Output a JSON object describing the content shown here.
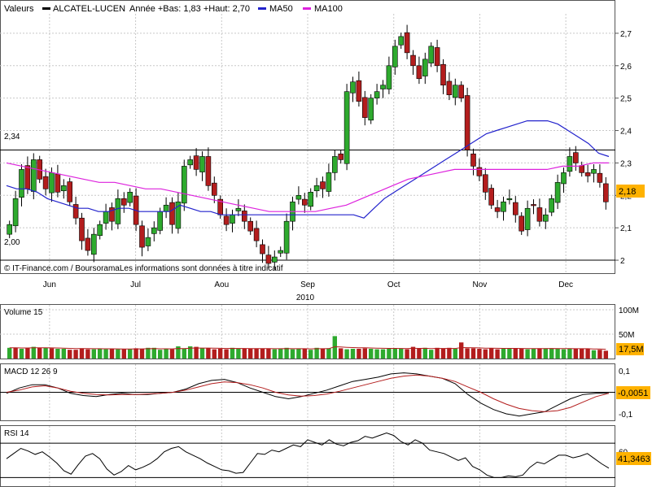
{
  "header": {
    "valeurs_label": "Valeurs",
    "series_label": "ALCATEL-LUCEN",
    "range_text": "Année +Bas: 1,83 +Haut: 2,70",
    "ma50_label": "MA50",
    "ma100_label": "MA100"
  },
  "credits": "© IT-Finance.com / BoursoramaLes informations sont données à titre indicatif",
  "colors": {
    "up": "#2eaa2e",
    "down": "#b31d1d",
    "ma50": "#2222cc",
    "ma100": "#dd22dd",
    "label_bg": "#ffb200",
    "grid": "#c8c8c8",
    "background": "#ffffff"
  },
  "chart_data": [
    {
      "type": "candlestick",
      "title": "ALCATEL-LUCEN",
      "subtitle": "Année +Bas: 1,83 +Haut: 2,70",
      "xlabel": "2010",
      "months": [
        "Jun",
        "Jul",
        "Aou",
        "Sep",
        "Oct",
        "Nov",
        "Dec"
      ],
      "y_ticks": [
        "2",
        "2,1",
        "2,2",
        "2,3",
        "2,4",
        "2,5",
        "2,6",
        "2,7"
      ],
      "ylim": [
        1.96,
        2.76
      ],
      "reference_lines": [
        {
          "value": 2.34,
          "label": "2,34"
        },
        {
          "value": 2.0,
          "label": "2,00"
        }
      ],
      "last_value": "2,18",
      "series": [
        {
          "name": "ALCATEL-LUCEN",
          "type": "candlestick",
          "close": [
            2.11,
            2.19,
            2.28,
            2.22,
            2.31,
            2.25,
            2.22,
            2.27,
            2.21,
            2.23,
            2.18,
            2.13,
            2.06,
            2.03,
            2.08,
            2.11,
            2.15,
            2.12,
            2.19,
            2.17,
            2.21,
            2.11,
            2.04,
            2.07,
            2.1,
            2.15,
            2.17,
            2.11,
            2.18,
            2.29,
            2.31,
            2.28,
            2.32,
            2.23,
            2.2,
            2.14,
            2.11,
            2.14,
            2.16,
            2.12,
            2.09,
            2.06,
            2.02,
            1.99,
            2.01,
            2.03,
            2.12,
            2.18,
            2.2,
            2.17,
            2.21,
            2.23,
            2.22,
            2.27,
            2.32,
            2.31,
            2.52,
            2.55,
            2.49,
            2.44,
            2.5,
            2.52,
            2.54,
            2.6,
            2.66,
            2.69,
            2.64,
            2.6,
            2.56,
            2.62,
            2.66,
            2.6,
            2.54,
            2.51,
            2.54,
            2.5,
            2.34,
            2.29,
            2.26,
            2.21,
            2.17,
            2.15,
            2.18,
            2.19,
            2.14,
            2.09,
            2.16,
            2.17,
            2.12,
            2.14,
            2.19,
            2.24,
            2.27,
            2.32,
            2.3,
            2.27,
            2.26,
            2.28,
            2.24,
            2.18
          ],
          "y_range": [
            1.97,
            2.71
          ]
        },
        {
          "name": "MA50",
          "values": [
            2.23,
            2.22,
            2.22,
            2.21,
            2.19,
            2.18,
            2.17,
            2.16,
            2.16,
            2.15,
            2.15,
            2.16,
            2.16,
            2.15,
            2.15,
            2.15,
            2.15,
            2.17,
            2.16,
            2.15,
            2.15,
            2.14,
            2.14,
            2.14,
            2.14,
            2.14,
            2.14,
            2.14,
            2.14,
            2.14,
            2.14,
            2.14,
            2.14,
            2.14,
            2.14,
            2.13,
            2.16,
            2.19,
            2.21,
            2.23,
            2.25,
            2.27,
            2.29,
            2.31,
            2.33,
            2.35,
            2.37,
            2.39,
            2.4,
            2.41,
            2.42,
            2.43,
            2.43,
            2.43,
            2.42,
            2.4,
            2.38,
            2.36,
            2.33,
            2.32
          ]
        },
        {
          "name": "MA100",
          "values": [
            2.3,
            2.29,
            2.28,
            2.27,
            2.26,
            2.25,
            2.24,
            2.24,
            2.23,
            2.22,
            2.22,
            2.21,
            2.2,
            2.19,
            2.18,
            2.17,
            2.16,
            2.15,
            2.15,
            2.15,
            2.15,
            2.16,
            2.17,
            2.19,
            2.21,
            2.23,
            2.25,
            2.26,
            2.27,
            2.28,
            2.28,
            2.28,
            2.28,
            2.28,
            2.28,
            2.28,
            2.29,
            2.29,
            2.3,
            2.3
          ]
        }
      ]
    },
    {
      "type": "bar",
      "title": "Volume 15",
      "y_ticks": [
        "50M",
        "100M"
      ],
      "ylim": [
        0,
        110
      ],
      "last_value": "17,5M",
      "values": [
        22,
        22,
        20,
        22,
        24,
        22,
        22,
        21,
        20,
        20,
        18,
        18,
        21,
        19,
        19,
        20,
        19,
        20,
        19,
        19,
        19,
        21,
        20,
        22,
        22,
        18,
        20,
        19,
        25,
        20,
        25,
        24,
        21,
        21,
        19,
        20,
        19,
        22,
        20,
        20,
        20,
        20,
        20,
        20,
        19,
        20,
        22,
        19,
        20,
        20,
        18,
        22,
        20,
        21,
        46,
        21,
        19,
        20,
        20,
        21,
        20,
        19,
        19,
        20,
        21,
        20,
        19,
        24,
        20,
        22,
        18,
        22,
        20,
        22,
        20,
        33,
        21,
        21,
        20,
        19,
        21,
        19,
        20,
        21,
        21,
        20,
        19,
        20,
        21,
        21,
        21,
        20,
        19,
        20,
        20,
        20,
        20,
        17,
        18,
        16
      ],
      "up_flags": [
        1,
        0,
        1,
        0,
        1,
        0,
        1,
        0,
        1,
        1,
        0,
        0,
        0,
        0,
        1,
        1,
        1,
        0,
        1,
        0,
        1,
        0,
        0,
        1,
        1,
        1,
        1,
        0,
        1,
        1,
        1,
        0,
        1,
        0,
        0,
        0,
        0,
        1,
        1,
        0,
        0,
        0,
        0,
        0,
        1,
        1,
        1,
        1,
        1,
        0,
        1,
        1,
        0,
        1,
        1,
        0,
        1,
        1,
        0,
        0,
        1,
        1,
        1,
        1,
        1,
        1,
        0,
        0,
        0,
        1,
        1,
        0,
        0,
        0,
        1,
        0,
        0,
        0,
        0,
        0,
        0,
        0,
        1,
        1,
        0,
        0,
        1,
        1,
        0,
        1,
        1,
        1,
        1,
        1,
        0,
        0,
        0,
        1,
        0,
        0
      ]
    },
    {
      "type": "line",
      "title": "MACD 12 26 9",
      "y_ticks": [
        "-0,1",
        "0,1"
      ],
      "ylim": [
        -0.13,
        0.13
      ],
      "last_value": "-0,0051",
      "series": [
        {
          "name": "MACD",
          "values": [
            -0.005,
            0.02,
            0.035,
            0.035,
            0.02,
            -0.005,
            -0.015,
            -0.02,
            -0.01,
            -0.005,
            -0.01,
            -0.01,
            -0.005,
            0.0,
            0.015,
            0.04,
            0.055,
            0.06,
            0.045,
            0.02,
            0.0,
            -0.02,
            -0.03,
            -0.02,
            -0.005,
            0.01,
            0.03,
            0.05,
            0.06,
            0.07,
            0.085,
            0.09,
            0.085,
            0.075,
            0.065,
            0.04,
            -0.01,
            -0.05,
            -0.08,
            -0.1,
            -0.11,
            -0.1,
            -0.09,
            -0.06,
            -0.03,
            -0.01,
            -0.005,
            -0.005
          ]
        },
        {
          "name": "Signal",
          "values": [
            0.0,
            0.01,
            0.025,
            0.03,
            0.02,
            0.005,
            -0.005,
            -0.01,
            -0.012,
            -0.01,
            -0.01,
            -0.008,
            -0.005,
            0.0,
            0.01,
            0.025,
            0.04,
            0.048,
            0.045,
            0.035,
            0.02,
            0.0,
            -0.012,
            -0.018,
            -0.015,
            -0.008,
            0.005,
            0.02,
            0.035,
            0.05,
            0.065,
            0.075,
            0.08,
            0.075,
            0.065,
            0.05,
            0.025,
            0.0,
            -0.03,
            -0.055,
            -0.075,
            -0.085,
            -0.09,
            -0.085,
            -0.07,
            -0.045,
            -0.02,
            -0.005
          ]
        }
      ]
    },
    {
      "type": "line",
      "title": "RSI 14",
      "y_ticks": [
        "60"
      ],
      "ylim": [
        20,
        90
      ],
      "last_value": "41,3463",
      "series": [
        {
          "name": "RSI 14",
          "values": [
            52,
            58,
            64,
            61,
            57,
            60,
            54,
            47,
            38,
            34,
            45,
            55,
            58,
            52,
            40,
            33,
            37,
            44,
            39,
            42,
            46,
            52,
            60,
            64,
            66,
            60,
            56,
            52,
            47,
            43,
            39,
            38,
            35,
            36,
            47,
            58,
            57,
            62,
            60,
            64,
            68,
            66,
            74,
            71,
            68,
            74,
            69,
            67,
            71,
            73,
            78,
            76,
            79,
            82,
            79,
            72,
            68,
            74,
            70,
            62,
            60,
            58,
            54,
            50,
            53,
            43,
            39,
            33,
            30,
            30,
            32,
            31,
            33,
            42,
            48,
            46,
            51,
            56,
            56,
            53,
            55,
            58,
            52,
            46,
            41
          ]
        }
      ]
    }
  ]
}
